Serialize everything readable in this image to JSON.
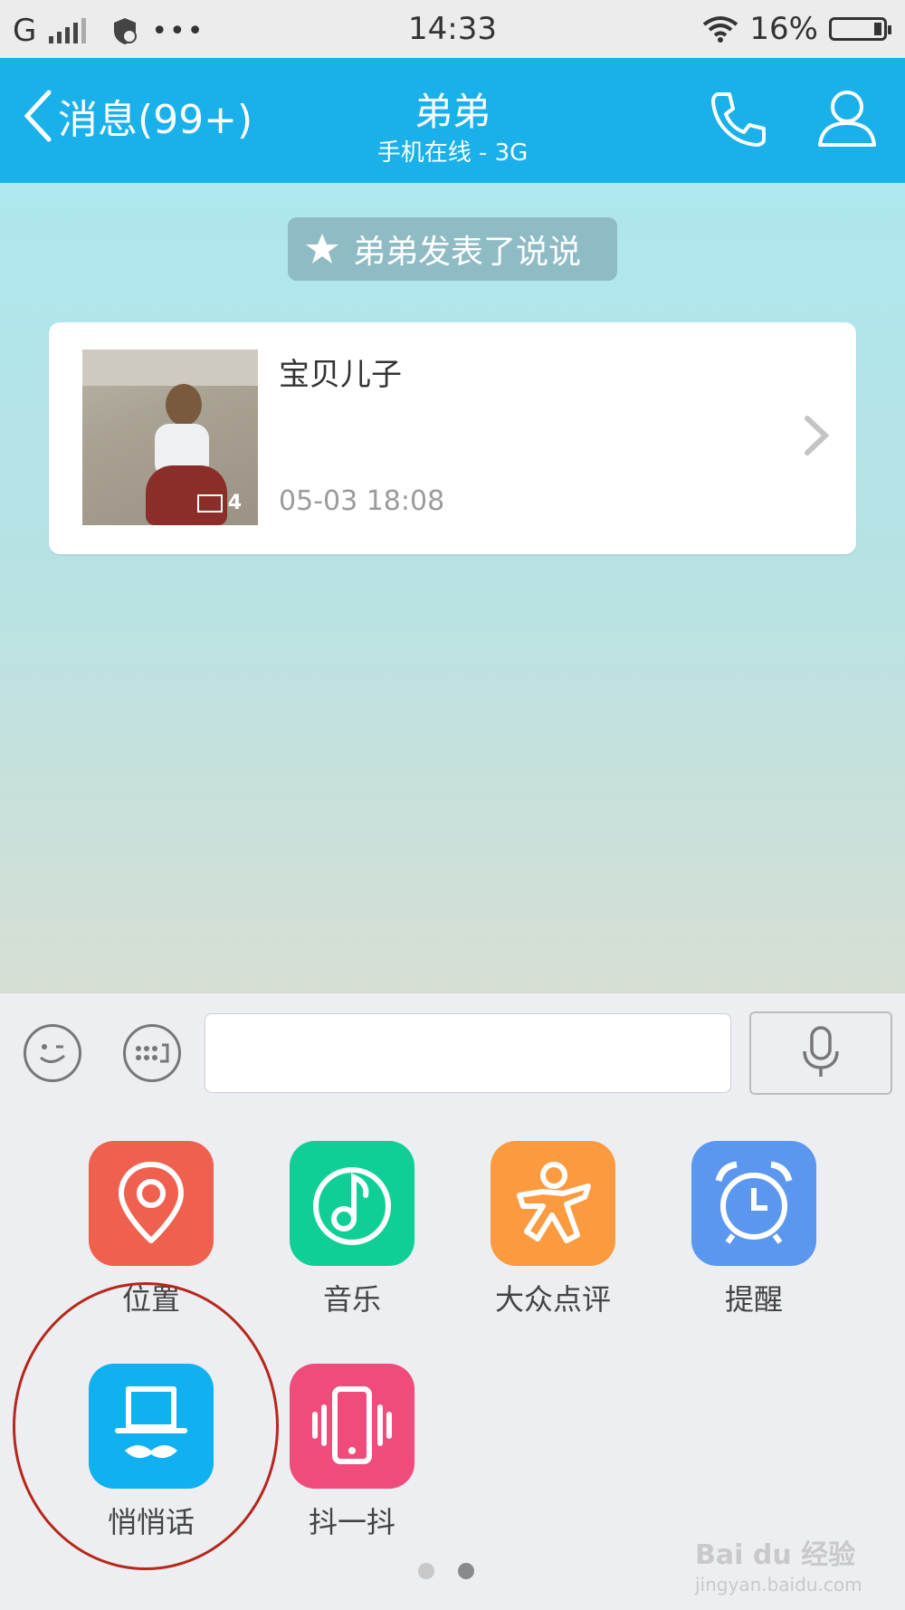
{
  "status_bar": {
    "carrier": "G",
    "time": "14:33",
    "battery_percent": "16%",
    "battery_level": 0.16,
    "icons": [
      "signal-icon",
      "shield-icon",
      "more-icon",
      "wifi-icon",
      "battery-icon"
    ]
  },
  "header": {
    "back_label": "消息(99+)",
    "title": "弟弟",
    "subtitle": "手机在线 - 3G",
    "accent": "#1ab1ea"
  },
  "notice": {
    "text": "弟弟发表了说说"
  },
  "post_card": {
    "title": "宝贝儿子",
    "image_count": "4",
    "timestamp": "05-03 18:08"
  },
  "input_bar": {
    "message_value": "",
    "icons": [
      "emoji-icon",
      "keyboard-icon",
      "microphone-icon"
    ]
  },
  "apps": [
    {
      "label": "位置",
      "color": "#f0604f",
      "icon": "location-pin-icon"
    },
    {
      "label": "音乐",
      "color": "#0fcf97",
      "icon": "music-note-icon"
    },
    {
      "label": "大众点评",
      "color": "#fc9a3f",
      "icon": "dianping-person-icon"
    },
    {
      "label": "提醒",
      "color": "#5b97ee",
      "icon": "alarm-clock-icon"
    },
    {
      "label": "悄悄话",
      "color": "#10b1f0",
      "icon": "top-hat-mustache-icon"
    },
    {
      "label": "抖一抖",
      "color": "#ef4c7b",
      "icon": "vibrating-phone-icon"
    }
  ],
  "pager": {
    "pages": 2,
    "current": 2
  },
  "watermark": {
    "text": "Bai du 经验",
    "sub": "jingyan.baidu.com"
  }
}
